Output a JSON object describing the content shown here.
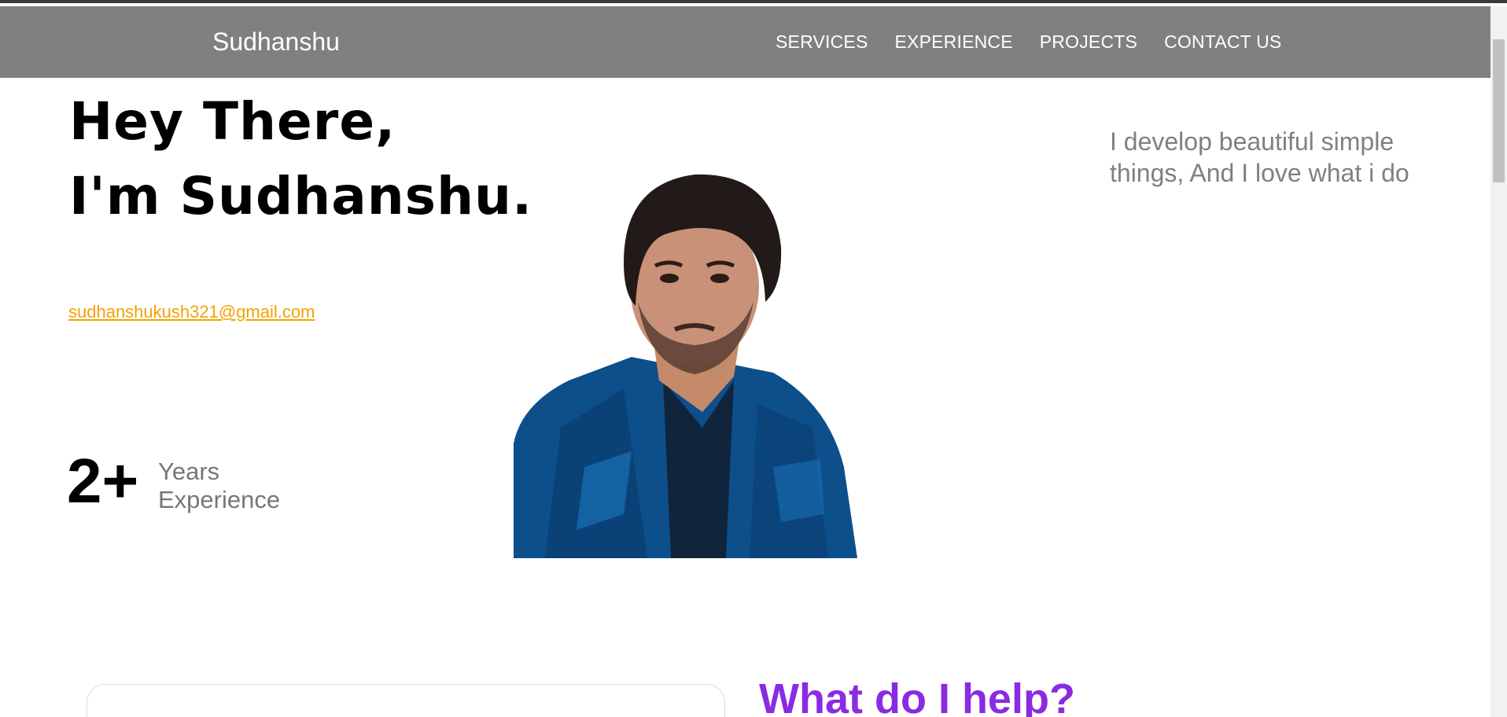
{
  "nav": {
    "brand": "Sudhanshu",
    "links": [
      "SERVICES",
      "EXPERIENCE",
      "PROJECTS",
      "CONTACT US"
    ]
  },
  "hero": {
    "greeting": "Hey There,",
    "name_line": "I'm Sudhanshu.",
    "email": "sudhanshukush321@gmail.com",
    "tagline": "I develop beautiful simple things, And I love what i do",
    "experience": {
      "number": "2+",
      "label_line1": "Years",
      "label_line2": "Experience"
    }
  },
  "help_section": {
    "title": "What do I help?"
  },
  "colors": {
    "navbar": "#808080",
    "email": "#f5a000",
    "help_title": "#8a2be2",
    "muted_text": "#808080"
  }
}
